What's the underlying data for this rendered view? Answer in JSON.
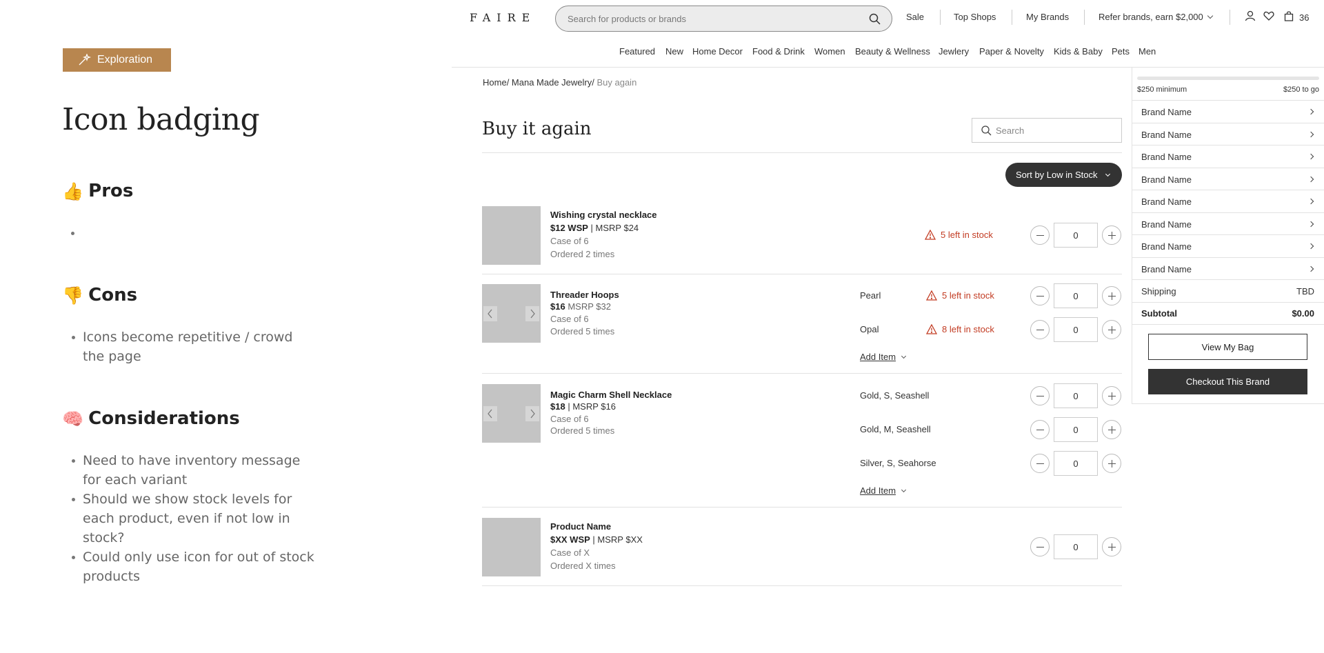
{
  "notes": {
    "tag": "Exploration",
    "title": "Icon badging",
    "pros": {
      "heading": "Pros",
      "emoji": "👍",
      "items": []
    },
    "cons": {
      "heading": "Cons",
      "emoji": "👎",
      "items": [
        "Icons become repetitive / crowd the page"
      ]
    },
    "considerations": {
      "heading": "Considerations",
      "emoji": "🧠",
      "items": [
        "Need to have inventory message for each variant",
        "Should we show stock levels for each product, even if not low in stock?",
        "Could only use icon for out of stock products"
      ]
    }
  },
  "header": {
    "logo": "FAIRE",
    "search_placeholder": "Search for products or brands",
    "nav": {
      "sale": "Sale",
      "top_shops": "Top Shops",
      "my_brands": "My Brands",
      "refer": "Refer brands, earn $2,000"
    },
    "bag_count": "36",
    "categories": [
      "Featured",
      "New",
      "Home Decor",
      "Food & Drink",
      "Women",
      "Beauty & Wellness",
      "Jewlery",
      "Paper & Novelty",
      "Kids & Baby",
      "Pets",
      "Men"
    ]
  },
  "breadcrumb": {
    "home": "Home",
    "brand": "Mana Made Jewelry",
    "current": "Buy again"
  },
  "page": {
    "title": "Buy it again",
    "search_placeholder": "Search",
    "sort_label": "Sort by Low in Stock",
    "add_item_label": "Add Item"
  },
  "products": [
    {
      "name": "Wishing crystal necklace",
      "wsp": "$12 WSP",
      "msrp": "MSRP $24",
      "case": "Case of 6",
      "ordered": "Ordered 2 times",
      "variants": [
        {
          "label": "",
          "stock": "5 left in stock",
          "qty": "0"
        }
      ]
    },
    {
      "name": "Threader Hoops",
      "wsp": "$16",
      "msrp": "MSRP $32",
      "case": "Case of 6",
      "ordered": "Ordered 5 times",
      "variants": [
        {
          "label": "Pearl",
          "stock": "5 left in stock",
          "qty": "0"
        },
        {
          "label": "Opal",
          "stock": "8 left in stock",
          "qty": "0"
        }
      ]
    },
    {
      "name": "Magic Charm Shell Necklace",
      "wsp": "$18",
      "msrp": "MSRP $16",
      "case": "Case of 6",
      "ordered": "Ordered 5 times",
      "variants": [
        {
          "label": "Gold, S, Seashell",
          "stock": "",
          "qty": "0"
        },
        {
          "label": "Gold, M, Seashell",
          "stock": "",
          "qty": "0"
        },
        {
          "label": "Silver, S, Seahorse",
          "stock": "",
          "qty": "0"
        }
      ]
    },
    {
      "name": "Product Name",
      "wsp": "$XX WSP",
      "msrp": "MSRP $XX",
      "case": "Case of X",
      "ordered": "Ordered X times",
      "variants": [
        {
          "label": "",
          "stock": "",
          "qty": "0"
        }
      ]
    }
  ],
  "cart": {
    "progress": 0.0,
    "minimum_label": "$250 minimum",
    "to_go_label": "$250 to go",
    "brands": [
      "Brand Name",
      "Brand Name",
      "Brand Name",
      "Brand Name",
      "Brand Name",
      "Brand Name",
      "Brand Name",
      "Brand Name"
    ],
    "shipping_label": "Shipping",
    "shipping_value": "TBD",
    "subtotal_label": "Subtotal",
    "subtotal_value": "$0.00",
    "view_bag": "View My Bag",
    "checkout": "Checkout This Brand"
  },
  "colors": {
    "accent": "#b8864f",
    "alert": "#c23b22",
    "dark": "#333333"
  }
}
